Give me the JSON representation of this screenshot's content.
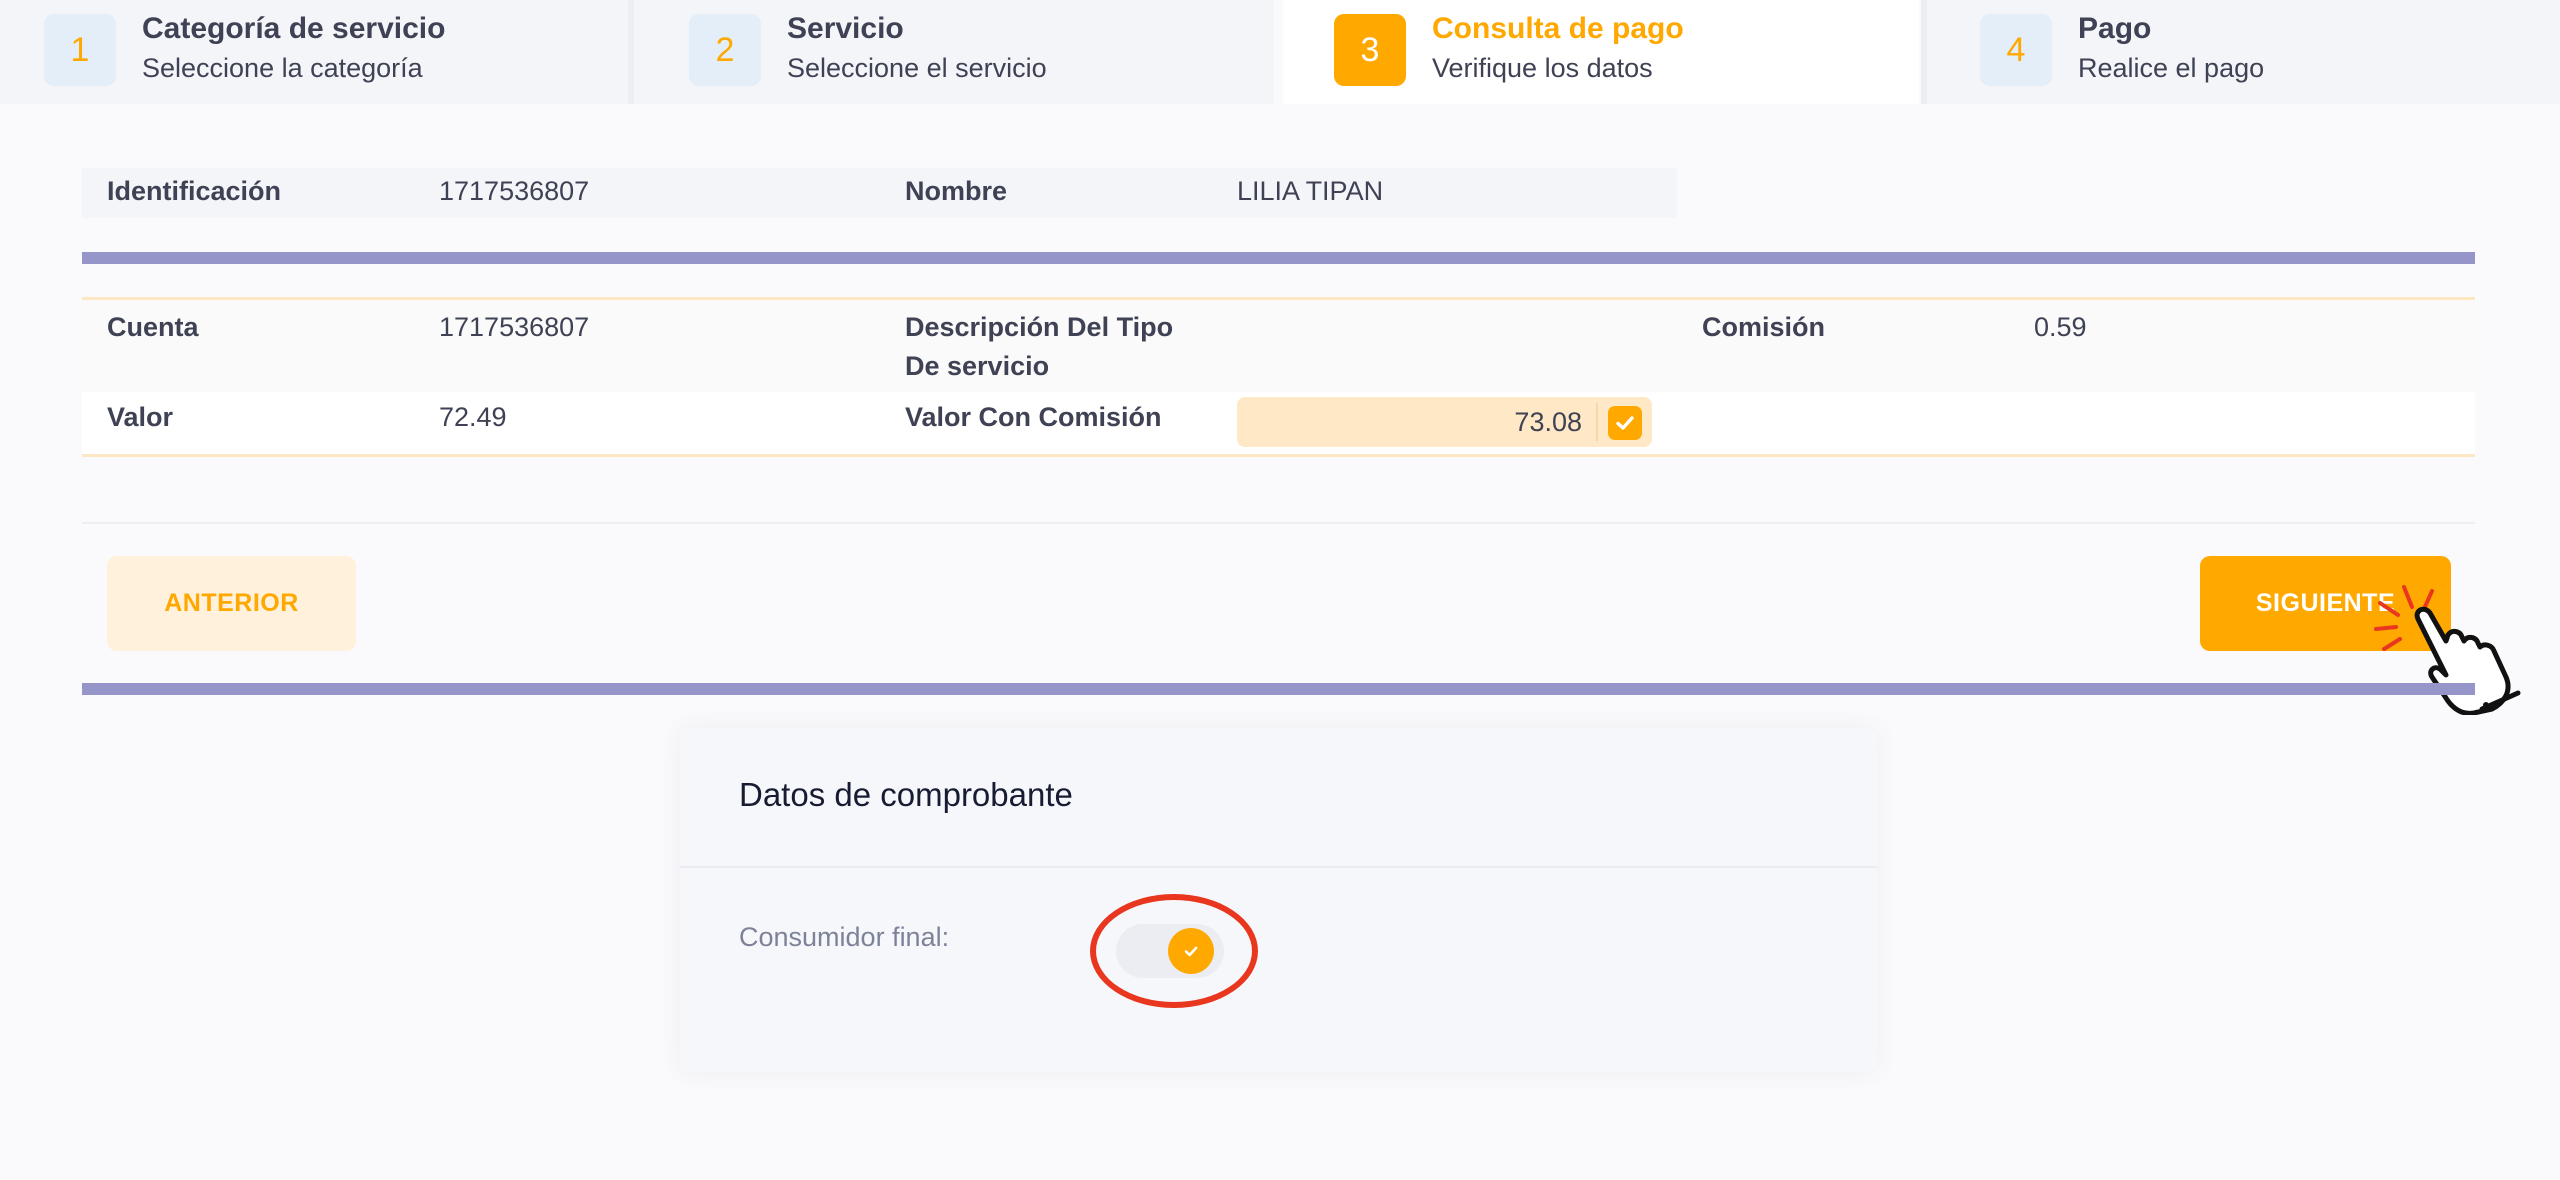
{
  "stepper": {
    "steps": [
      {
        "number": "1",
        "title": "Categoría de servicio",
        "subtitle": "Seleccione la categoría"
      },
      {
        "number": "2",
        "title": "Servicio",
        "subtitle": "Seleccione el servicio"
      },
      {
        "number": "3",
        "title": "Consulta de pago",
        "subtitle": "Verifique los datos"
      },
      {
        "number": "4",
        "title": "Pago",
        "subtitle": "Realice el pago"
      }
    ],
    "active_step": 3
  },
  "client": {
    "id_label": "Identificación",
    "id_value": "1717536807",
    "name_label": "Nombre",
    "name_value": "LILIA TIPAN"
  },
  "payment": {
    "account_label": "Cuenta",
    "account_value": "1717536807",
    "service_desc_label_line1": "Descripción Del Tipo",
    "service_desc_label_line2": "De servicio",
    "service_desc_value": "",
    "fee_label": "Comisión",
    "fee_value": "0.59",
    "amount_label": "Valor",
    "amount_value": "72.49",
    "amount_with_fee_label": "Valor Con Comisión",
    "amount_with_fee_value": "73.08",
    "amount_with_fee_checked": true
  },
  "actions": {
    "prev_label": "ANTERIOR",
    "next_label": "SIGUIENTE"
  },
  "receipt": {
    "title": "Datos de comprobante",
    "final_consumer_label": "Consumidor final:",
    "final_consumer_enabled": true
  },
  "colors": {
    "accent": "#ffa800",
    "divider": "#9595c9",
    "annotation": "#e8361f"
  }
}
